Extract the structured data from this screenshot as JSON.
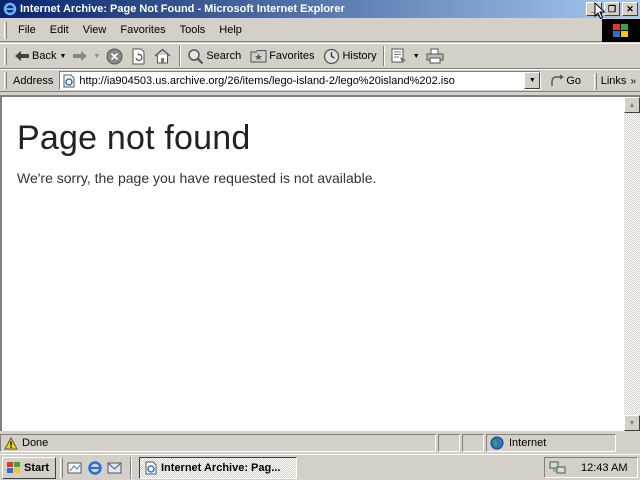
{
  "window": {
    "title": "Internet Archive: Page Not Found - Microsoft Internet Explorer",
    "minimize": "_",
    "restore": "❐",
    "close": "✕"
  },
  "menu": {
    "items": [
      "File",
      "Edit",
      "View",
      "Favorites",
      "Tools",
      "Help"
    ]
  },
  "toolbar": {
    "back_label": "Back",
    "search_label": "Search",
    "favorites_label": "Favorites",
    "history_label": "History"
  },
  "address": {
    "label": "Address",
    "url": "http://ia904503.us.archive.org/26/items/lego-island-2/lego%20island%202.iso",
    "go_label": "Go",
    "links_label": "Links"
  },
  "page": {
    "heading": "Page not found",
    "message": "We're sorry, the page you have requested is not available."
  },
  "status": {
    "text": "Done",
    "zone": "Internet"
  },
  "taskbar": {
    "start_label": "Start",
    "task_label": "Internet Archive: Pag...",
    "clock": "12:43 AM"
  }
}
